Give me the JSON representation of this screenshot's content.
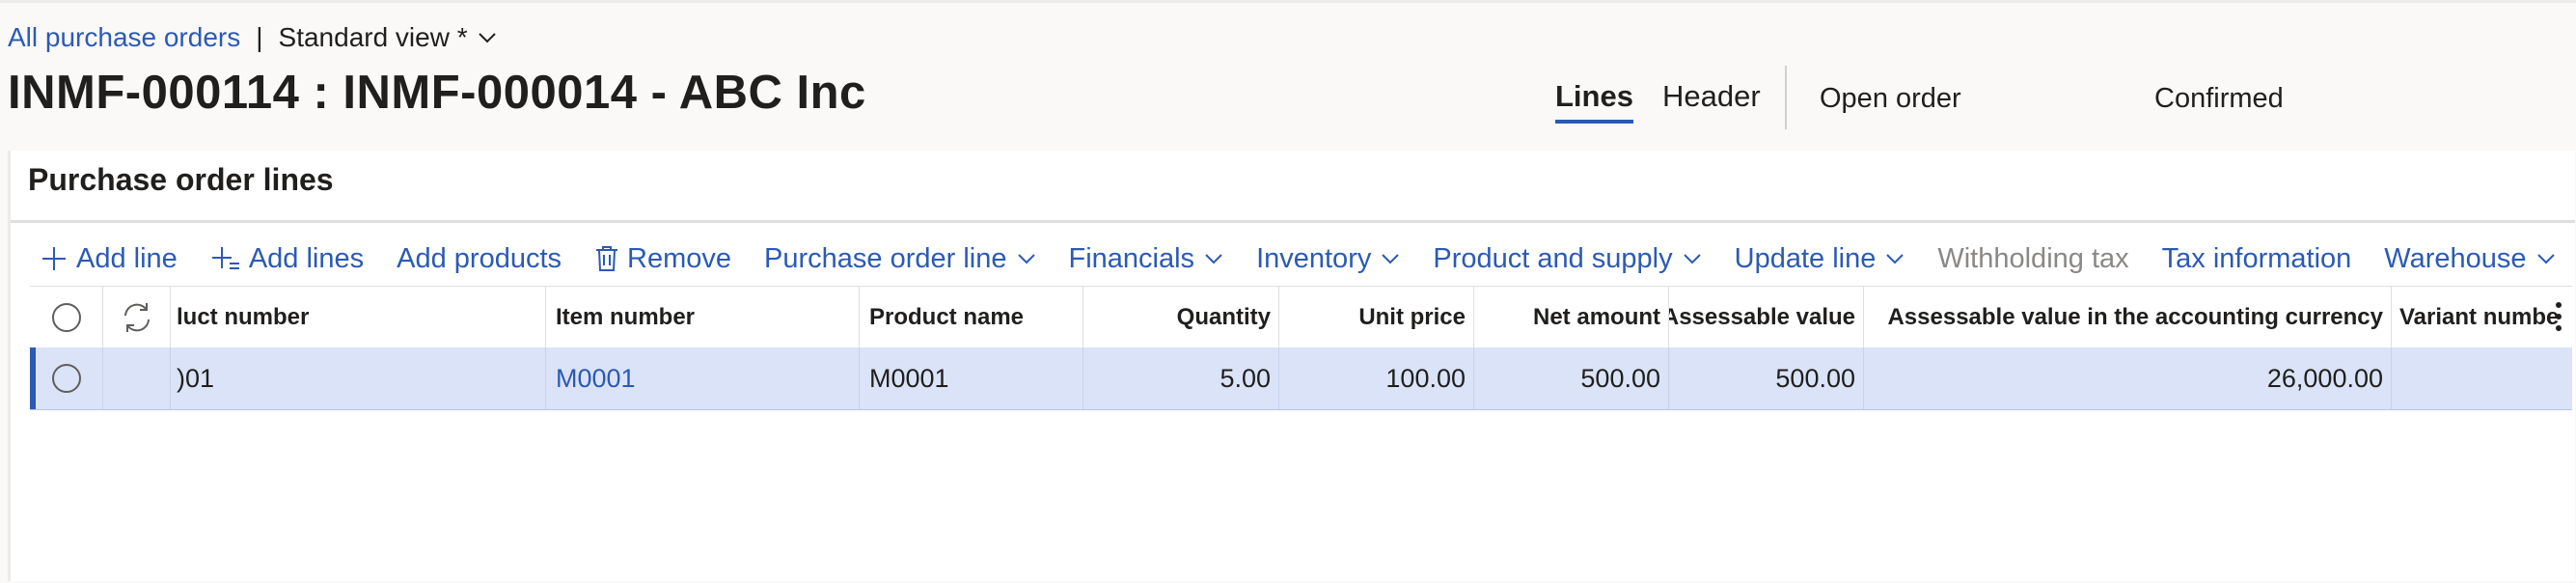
{
  "breadcrumb": {
    "link": "All purchase orders",
    "separator": "|",
    "view": "Standard view *"
  },
  "page_title": "INMF-000114 : INMF-000014 - ABC Inc",
  "tabs": [
    {
      "label": "Lines"
    },
    {
      "label": "Header"
    }
  ],
  "status": {
    "order_state": "Open order",
    "approval": "Confirmed"
  },
  "panel": {
    "title": "Purchase order lines"
  },
  "toolbar": {
    "add_line": "Add line",
    "add_lines": "Add lines",
    "add_products": "Add products",
    "remove": "Remove",
    "purchase_order_line": "Purchase order line",
    "financials": "Financials",
    "inventory": "Inventory",
    "product_and_supply": "Product and supply",
    "update_line": "Update line",
    "withholding_tax": "Withholding tax",
    "tax_information": "Tax information",
    "warehouse": "Warehouse"
  },
  "grid": {
    "columns": {
      "product_number": "luct number",
      "item_number": "Item number",
      "product_name": "Product name",
      "quantity": "Quantity",
      "unit_price": "Unit price",
      "net_amount": "Net amount",
      "assessable_value": "Assessable value",
      "assessable_value_acct": "Assessable value in the accounting currency",
      "variant_number": "Variant numbe"
    },
    "rows": [
      {
        "product_number": ")01",
        "item_number": "M0001",
        "product_name": "M0001",
        "quantity": "5.00",
        "unit_price": "100.00",
        "net_amount": "500.00",
        "assessable_value": "500.00",
        "assessable_value_acct": "26,000.00",
        "variant_number": ""
      }
    ]
  },
  "colors": {
    "accent": "#2b5ab5",
    "selected_row": "#dae3f7",
    "disabled": "#8a8886"
  },
  "icons": [
    "chevron-down-icon",
    "plus-icon",
    "add-lines-icon",
    "trash-icon",
    "refresh-icon",
    "more-icon"
  ]
}
